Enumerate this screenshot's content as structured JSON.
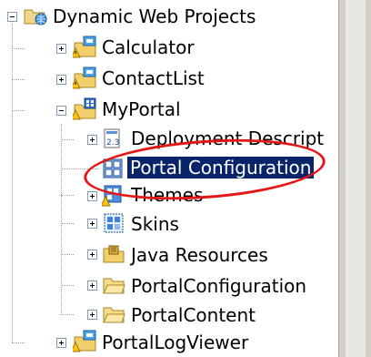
{
  "tree": {
    "root": {
      "label": "Dynamic Web Projects",
      "icon": "web-projects-folder-icon"
    },
    "items": [
      {
        "label": "Calculator",
        "icon": "dynamic-web-project-icon"
      },
      {
        "label": "ContactList",
        "icon": "dynamic-web-project-icon"
      },
      {
        "label": "MyPortal",
        "icon": "portal-project-icon"
      },
      {
        "label": "Deployment Descript",
        "icon": "deployment-descriptor-icon"
      },
      {
        "label": "Portal Configuration",
        "icon": "portal-configuration-icon"
      },
      {
        "label": "Themes",
        "icon": "themes-icon"
      },
      {
        "label": "Skins",
        "icon": "skins-icon"
      },
      {
        "label": "Java Resources",
        "icon": "java-resources-icon"
      },
      {
        "label": "PortalConfiguration",
        "icon": "folder-icon"
      },
      {
        "label": "PortalContent",
        "icon": "folder-icon"
      },
      {
        "label": "PortalLogViewer",
        "icon": "dynamic-web-project-icon"
      }
    ]
  },
  "colors": {
    "selection": "#0a246a",
    "highlight_oval": "#e41717"
  }
}
